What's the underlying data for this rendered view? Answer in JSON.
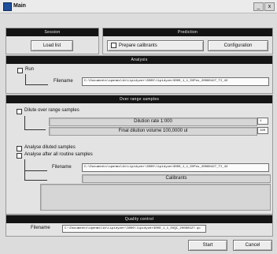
{
  "window": {
    "title": "Main",
    "minimize": "_",
    "close": "x"
  },
  "sections": {
    "session": "Session",
    "prediction": "Prediction",
    "analysis": "Analysis",
    "over_range": "Over range samples",
    "quality": "Quality control"
  },
  "session": {
    "load_button": "Load list"
  },
  "prediction": {
    "prepare_label": "Prepare calibrants",
    "configuration_button": "Configuration"
  },
  "analysis": {
    "run_label": "Run",
    "filename_label": "Filename",
    "filename_value": "C:\\Documents\\openmslib\\Lipidyzer\\3000\\lipidyzer3000_1_1_SVPos_20080427_TI_42"
  },
  "over_range": {
    "dilute_label": "Dilute over range samples",
    "dilution_rate_label": "Dilution rate 1:000",
    "dilution_rate_value": "1",
    "final_volume_label": "Final dilution volume 100,0000 ul",
    "final_volume_value": "100",
    "analyse_diluted_label": "Analyse diluted samples",
    "analyse_after_label": "Analyse after all routine samples",
    "filename_label": "Filename",
    "filename_value": "C:\\Documents\\openmslib\\Lipidyzer\\3000\\lipidyzer3000_1_1_SVPos_20080427_TI_42",
    "calibrants_label": "Calibrants"
  },
  "quality": {
    "filename_label": "Filename",
    "filename_value": "C:\\Documents\\openmslib\\Lipidyzer\\3000\\lipidyzer3000_1_1_SVQC_20080427.qc"
  },
  "footer": {
    "start_button": "Start",
    "cancel_button": "Cancel"
  }
}
